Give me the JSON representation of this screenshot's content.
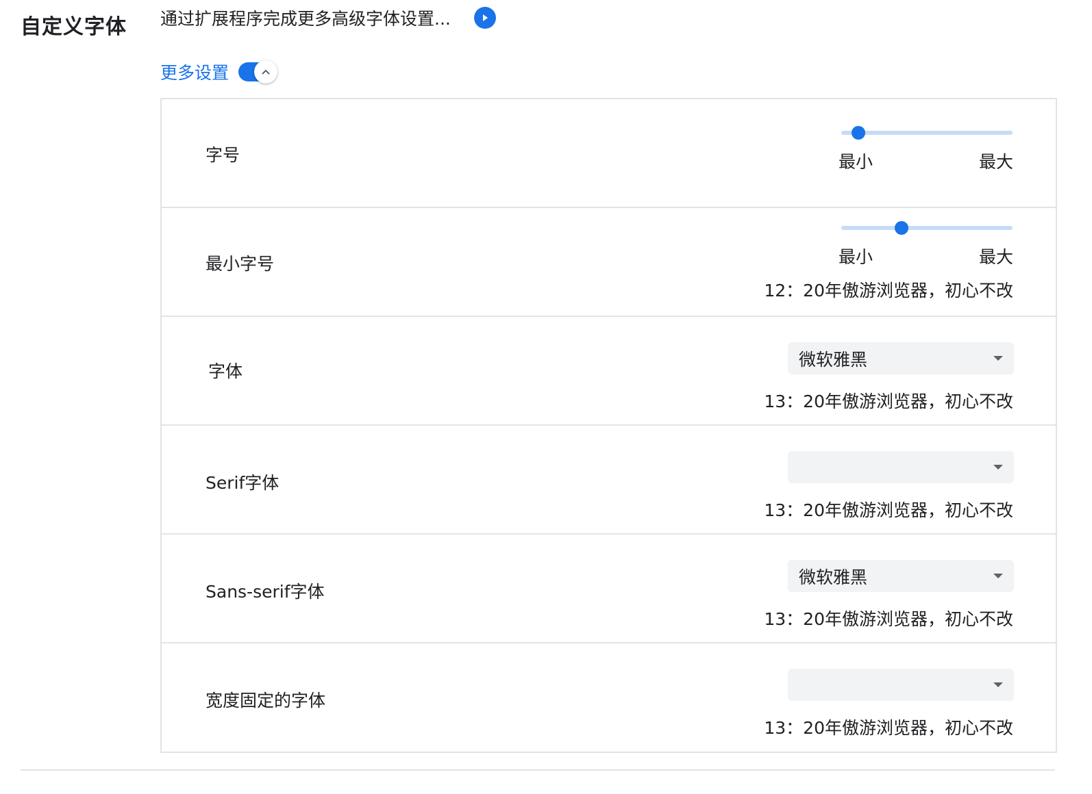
{
  "section_title": "自定义字体",
  "extension": {
    "text": "通过扩展程序完成更多高级字体设置...",
    "button_icon": "play-arrow-icon"
  },
  "more_settings": {
    "label": "更多设置",
    "toggle_on": true,
    "toggle_icon": "chevron-up-icon"
  },
  "colors": {
    "accent": "#1a73e8",
    "track": "#c7dbf7",
    "select_bg": "#f1f3f4",
    "divider": "#e3e3e3"
  },
  "rows": {
    "font_size": {
      "label": "字号",
      "slider_min_label": "最小",
      "slider_max_label": "最大",
      "slider_value_fraction": 0.1
    },
    "min_font_size": {
      "label": "最小字号",
      "slider_min_label": "最小",
      "slider_max_label": "最大",
      "slider_value_fraction": 0.35,
      "preview": "12：20年傲游浏览器，初心不改"
    },
    "standard_font": {
      "label": "字体",
      "selected": "微软雅黑",
      "preview": "13：20年傲游浏览器，初心不改"
    },
    "serif_font": {
      "label": "Serif字体",
      "selected": "",
      "preview": "13：20年傲游浏览器，初心不改"
    },
    "sans_serif_font": {
      "label": "Sans-serif字体",
      "selected": "微软雅黑",
      "preview": "13：20年傲游浏览器，初心不改"
    },
    "fixed_width_font": {
      "label": "宽度固定的字体",
      "selected": "",
      "preview": "13：20年傲游浏览器，初心不改"
    }
  }
}
